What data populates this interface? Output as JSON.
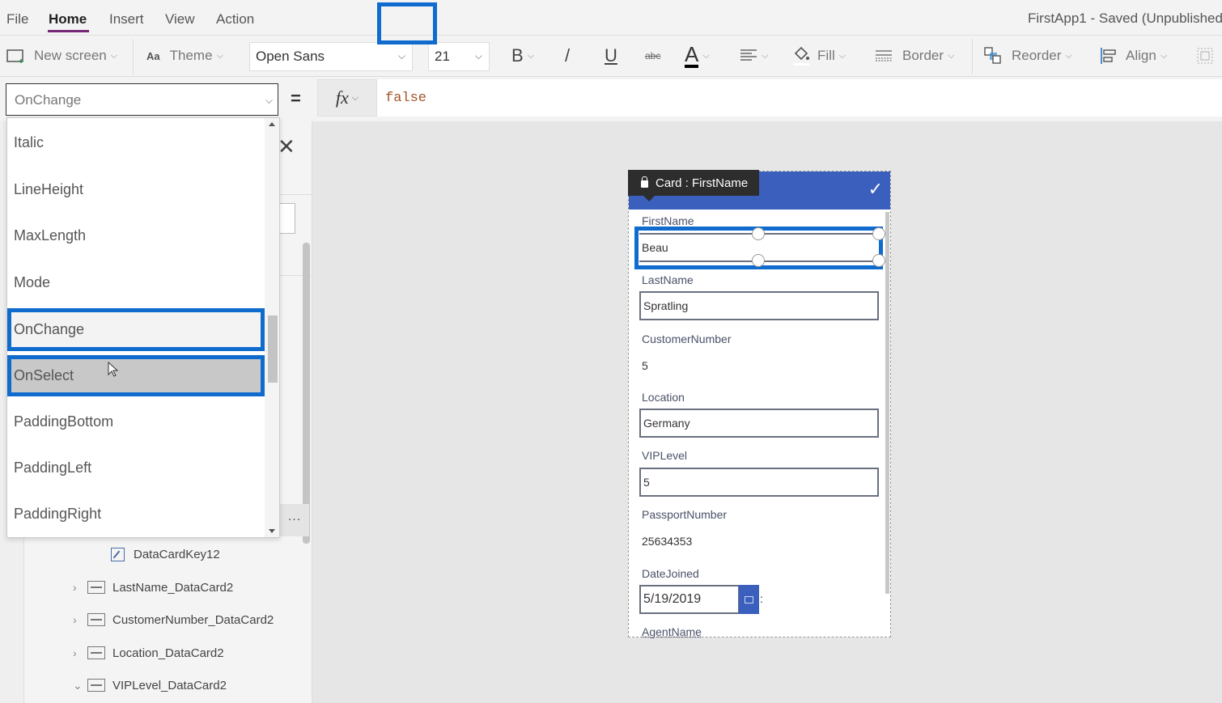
{
  "menubar": {
    "items": [
      {
        "label": "File",
        "active": false
      },
      {
        "label": "Home",
        "active": true
      },
      {
        "label": "Insert",
        "active": false
      },
      {
        "label": "View",
        "active": false
      },
      {
        "label": "Action",
        "active": false
      }
    ],
    "app_title": "FirstApp1 - Saved (Unpublished)"
  },
  "toolbar": {
    "new_screen": "New screen",
    "theme": "Theme",
    "font": "Open Sans",
    "font_size": "21",
    "bold": "B",
    "italic": "/",
    "underline": "U",
    "strikethrough": "abc",
    "font_color": "A",
    "fill": "Fill",
    "border": "Border",
    "reorder": "Reorder",
    "align": "Align"
  },
  "formulabar": {
    "property": "OnChange",
    "equals": "=",
    "fx_label": "fx",
    "formula": "false"
  },
  "property_dropdown": {
    "items": [
      {
        "label": "Italic",
        "state": "normal"
      },
      {
        "label": "LineHeight",
        "state": "normal"
      },
      {
        "label": "MaxLength",
        "state": "normal"
      },
      {
        "label": "Mode",
        "state": "normal"
      },
      {
        "label": "OnChange",
        "state": "current"
      },
      {
        "label": "OnSelect",
        "state": "hover"
      },
      {
        "label": "PaddingBottom",
        "state": "normal"
      },
      {
        "label": "PaddingLeft",
        "state": "normal"
      },
      {
        "label": "PaddingRight",
        "state": "normal"
      }
    ]
  },
  "tree_view": {
    "items": [
      {
        "label": "DataCardKey12",
        "icon": "edit-icon",
        "expander": ""
      },
      {
        "label": "LastName_DataCard2",
        "icon": "card-icon",
        "expander": "›"
      },
      {
        "label": "CustomerNumber_DataCard2",
        "icon": "card-icon",
        "expander": "›"
      },
      {
        "label": "Location_DataCard2",
        "icon": "card-icon",
        "expander": "›"
      },
      {
        "label": "VIPLevel_DataCard2",
        "icon": "card-icon",
        "expander": "⌄"
      }
    ],
    "more_label": "..."
  },
  "form": {
    "card_tag": "Card : FirstName",
    "fields": [
      {
        "label": "FirstName",
        "value": "Beau",
        "type": "input"
      },
      {
        "label": "LastName",
        "value": "Spratling",
        "type": "input"
      },
      {
        "label": "CustomerNumber",
        "value": "5",
        "type": "text"
      },
      {
        "label": "Location",
        "value": "Germany",
        "type": "input"
      },
      {
        "label": "VIPLevel",
        "value": "5",
        "type": "input"
      },
      {
        "label": "PassportNumber",
        "value": "25634353",
        "type": "text"
      },
      {
        "label": "DateJoined",
        "value": "5/19/2019",
        "type": "date"
      },
      {
        "label": "AgentName",
        "value": "",
        "type": "label"
      }
    ],
    "date_suffix": ":"
  },
  "colors": {
    "accent_highlight": "#0f6cce",
    "form_header": "#3a5fbd",
    "menu_underline": "#742774",
    "formula_text": "#a3542a"
  }
}
